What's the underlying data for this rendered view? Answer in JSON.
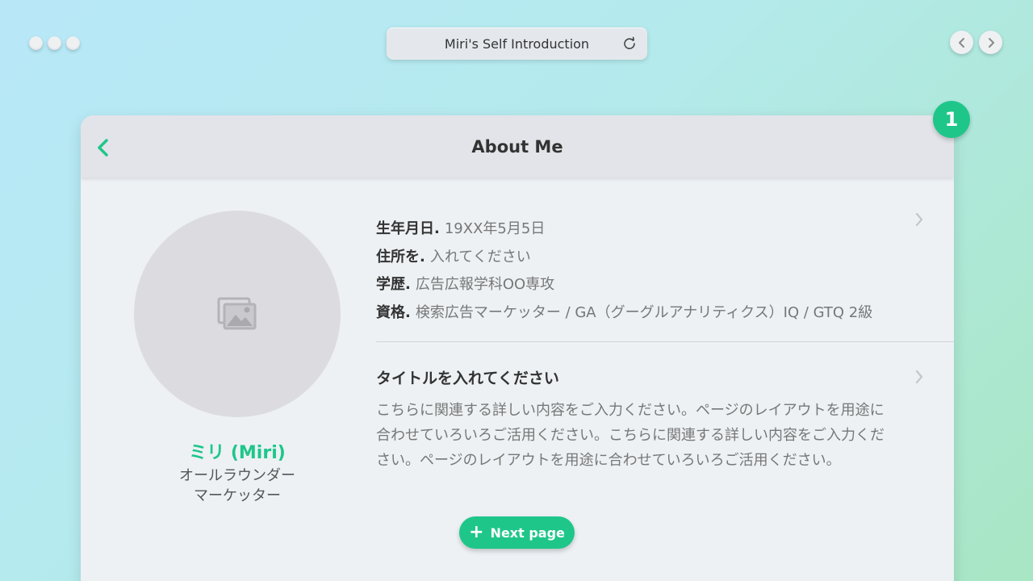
{
  "window": {
    "title": "Miri's Self Introduction"
  },
  "header": {
    "title": "About Me",
    "badge": "1"
  },
  "profile": {
    "name": "ミリ (Miri)",
    "role_line1": "オールラウンダー",
    "role_line2": "マーケッター"
  },
  "info": [
    {
      "label": "生年月日.",
      "value": "19XX年5月5日"
    },
    {
      "label": "住所を.",
      "value": "入れてください"
    },
    {
      "label": "学歴.",
      "value": "広告広報学科OO専攻"
    },
    {
      "label": "資格.",
      "value": "検索広告マーケッター / GA（グーグルアナリティクス）IQ / GTQ 2級"
    }
  ],
  "section": {
    "title": "タイトルを入れてください",
    "body": "こちらに関連する詳しい内容をご入力ください。ページのレイアウトを用途に合わせていろいろご活用ください。こちらに関連する詳しい内容をご入力ください。ページのレイアウトを用途に合わせていろいろご活用ください。"
  },
  "next_button": {
    "icon": "plus-icon",
    "label": "Next page"
  },
  "colors": {
    "accent": "#1fc68a",
    "card": "#edf1f4",
    "header": "#e3e4e9"
  }
}
